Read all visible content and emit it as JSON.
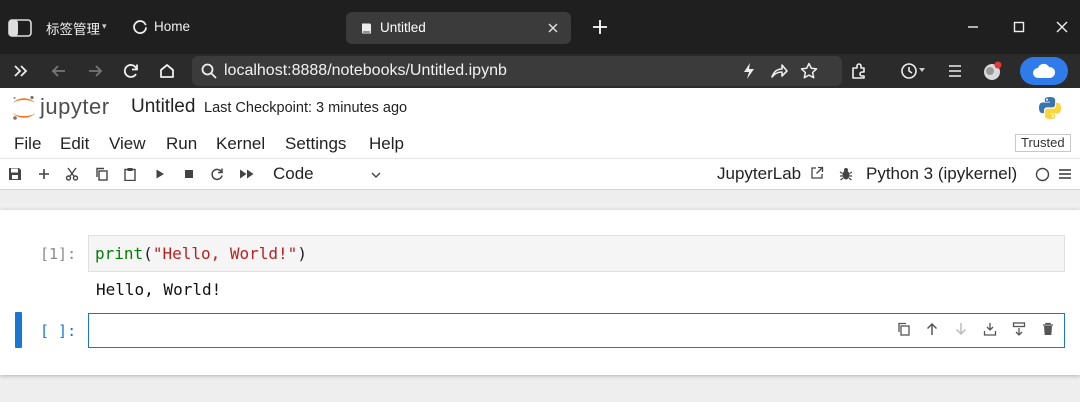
{
  "browser": {
    "tab_group_label": "标签管理",
    "tab_group_caret": "▾",
    "home_tab_label": "Home",
    "active_tab_label": "Untitled",
    "address_url": "localhost:8888/notebooks/Untitled.ipynb",
    "accent_color": "#2f7bea"
  },
  "jupyter": {
    "brand": "jupyter",
    "notebook_title": "Untitled",
    "checkpoint_text": "Last Checkpoint: 3 minutes ago",
    "menu": [
      "File",
      "Edit",
      "View",
      "Run",
      "Kernel",
      "Settings",
      "Help"
    ],
    "trusted_label": "Trusted",
    "cell_type": "Code",
    "jupyterlab_label": "JupyterLab",
    "kernel_name": "Python 3 (ipykernel)",
    "accent_color": "#1976d2"
  },
  "cells": [
    {
      "prompt": "[1]:",
      "code_fn": "print",
      "code_open": "(",
      "code_str": "\"Hello, World!\"",
      "code_close": ")",
      "output": "Hello, World!"
    },
    {
      "prompt": "[ ]:"
    }
  ]
}
